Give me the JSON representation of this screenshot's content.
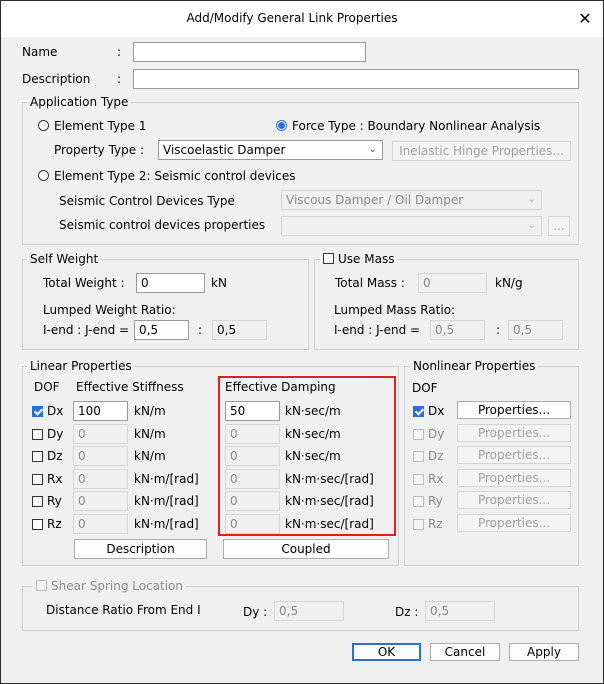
{
  "window": {
    "title": "Add/Modify General Link Properties"
  },
  "general": {
    "name_label": "Name",
    "name_value": "",
    "description_label": "Description",
    "description_value": "",
    "colon": ":"
  },
  "application_type": {
    "title": "Application Type",
    "element_type_1": "Element Type 1",
    "force_type": "Force Type : Boundary Nonlinear Analysis",
    "property_type_label": "Property Type :",
    "property_type_value": "Viscoelastic Damper",
    "inelastic_hinge_button": "Inelastic Hinge Properties...",
    "element_type_2": "Element Type 2: Seismic control devices",
    "seismic_type_label": "Seismic Control Devices Type",
    "seismic_type_value": "Viscous Damper / Oil Damper",
    "seismic_props_label": "Seismic control devices properties",
    "seismic_props_value": "",
    "ellipsis_button": "..."
  },
  "self_weight": {
    "title": "Self Weight",
    "total_weight_label": "Total Weight :",
    "total_weight_value": "0",
    "total_weight_unit": "kN",
    "lumped_label": "Lumped Weight Ratio:",
    "iend_label": "I-end : J-end =",
    "i_value": "0,5",
    "sep": ":",
    "j_value": "0,5"
  },
  "use_mass": {
    "title": "Use Mass",
    "total_mass_label": "Total Mass :",
    "total_mass_value": "0",
    "total_mass_unit": "kN/g",
    "lumped_label": "Lumped Mass Ratio:",
    "iend_label": "I-end : J-end =",
    "i_value": "0,5",
    "sep": ":",
    "j_value": "0,5"
  },
  "linear": {
    "title": "Linear Properties",
    "dof_header": "DOF",
    "stiffness_header": "Effective Stiffness",
    "damping_header": "Effective Damping",
    "rows": [
      {
        "dof": "Dx",
        "checked": true,
        "stiffness": "100",
        "s_unit": "kN/m",
        "damping": "50",
        "d_unit": "kN·sec/m"
      },
      {
        "dof": "Dy",
        "checked": false,
        "stiffness": "0",
        "s_unit": "kN/m",
        "damping": "0",
        "d_unit": "kN·sec/m"
      },
      {
        "dof": "Dz",
        "checked": false,
        "stiffness": "0",
        "s_unit": "kN/m",
        "damping": "0",
        "d_unit": "kN·sec/m"
      },
      {
        "dof": "Rx",
        "checked": false,
        "stiffness": "0",
        "s_unit": "kN·m/[rad]",
        "damping": "0",
        "d_unit": "kN·m·sec/[rad]"
      },
      {
        "dof": "Ry",
        "checked": false,
        "stiffness": "0",
        "s_unit": "kN·m/[rad]",
        "damping": "0",
        "d_unit": "kN·m·sec/[rad]"
      },
      {
        "dof": "Rz",
        "checked": false,
        "stiffness": "0",
        "s_unit": "kN·m/[rad]",
        "damping": "0",
        "d_unit": "kN·m·sec/[rad]"
      }
    ],
    "description_button": "Description",
    "coupled_button": "Coupled",
    "highlight_color": "#e02020"
  },
  "nonlinear": {
    "title": "Nonlinear Properties",
    "dof_header": "DOF",
    "rows": [
      {
        "dof": "Dx",
        "checked": true,
        "button": "Properties..."
      },
      {
        "dof": "Dy",
        "checked": false,
        "button": "Properties..."
      },
      {
        "dof": "Dz",
        "checked": false,
        "button": "Properties..."
      },
      {
        "dof": "Rx",
        "checked": false,
        "button": "Properties..."
      },
      {
        "dof": "Ry",
        "checked": false,
        "button": "Properties..."
      },
      {
        "dof": "Rz",
        "checked": false,
        "button": "Properties..."
      }
    ]
  },
  "shear_spring": {
    "title": "Shear Spring Location",
    "distance_label": "Distance Ratio From End I",
    "dy_label": "Dy :",
    "dy_value": "0,5",
    "dz_label": "Dz :",
    "dz_value": "0,5"
  },
  "footer": {
    "ok": "OK",
    "cancel": "Cancel",
    "apply": "Apply"
  },
  "colors": {
    "accent": "#2b6fd8",
    "highlight": "#e02020"
  }
}
